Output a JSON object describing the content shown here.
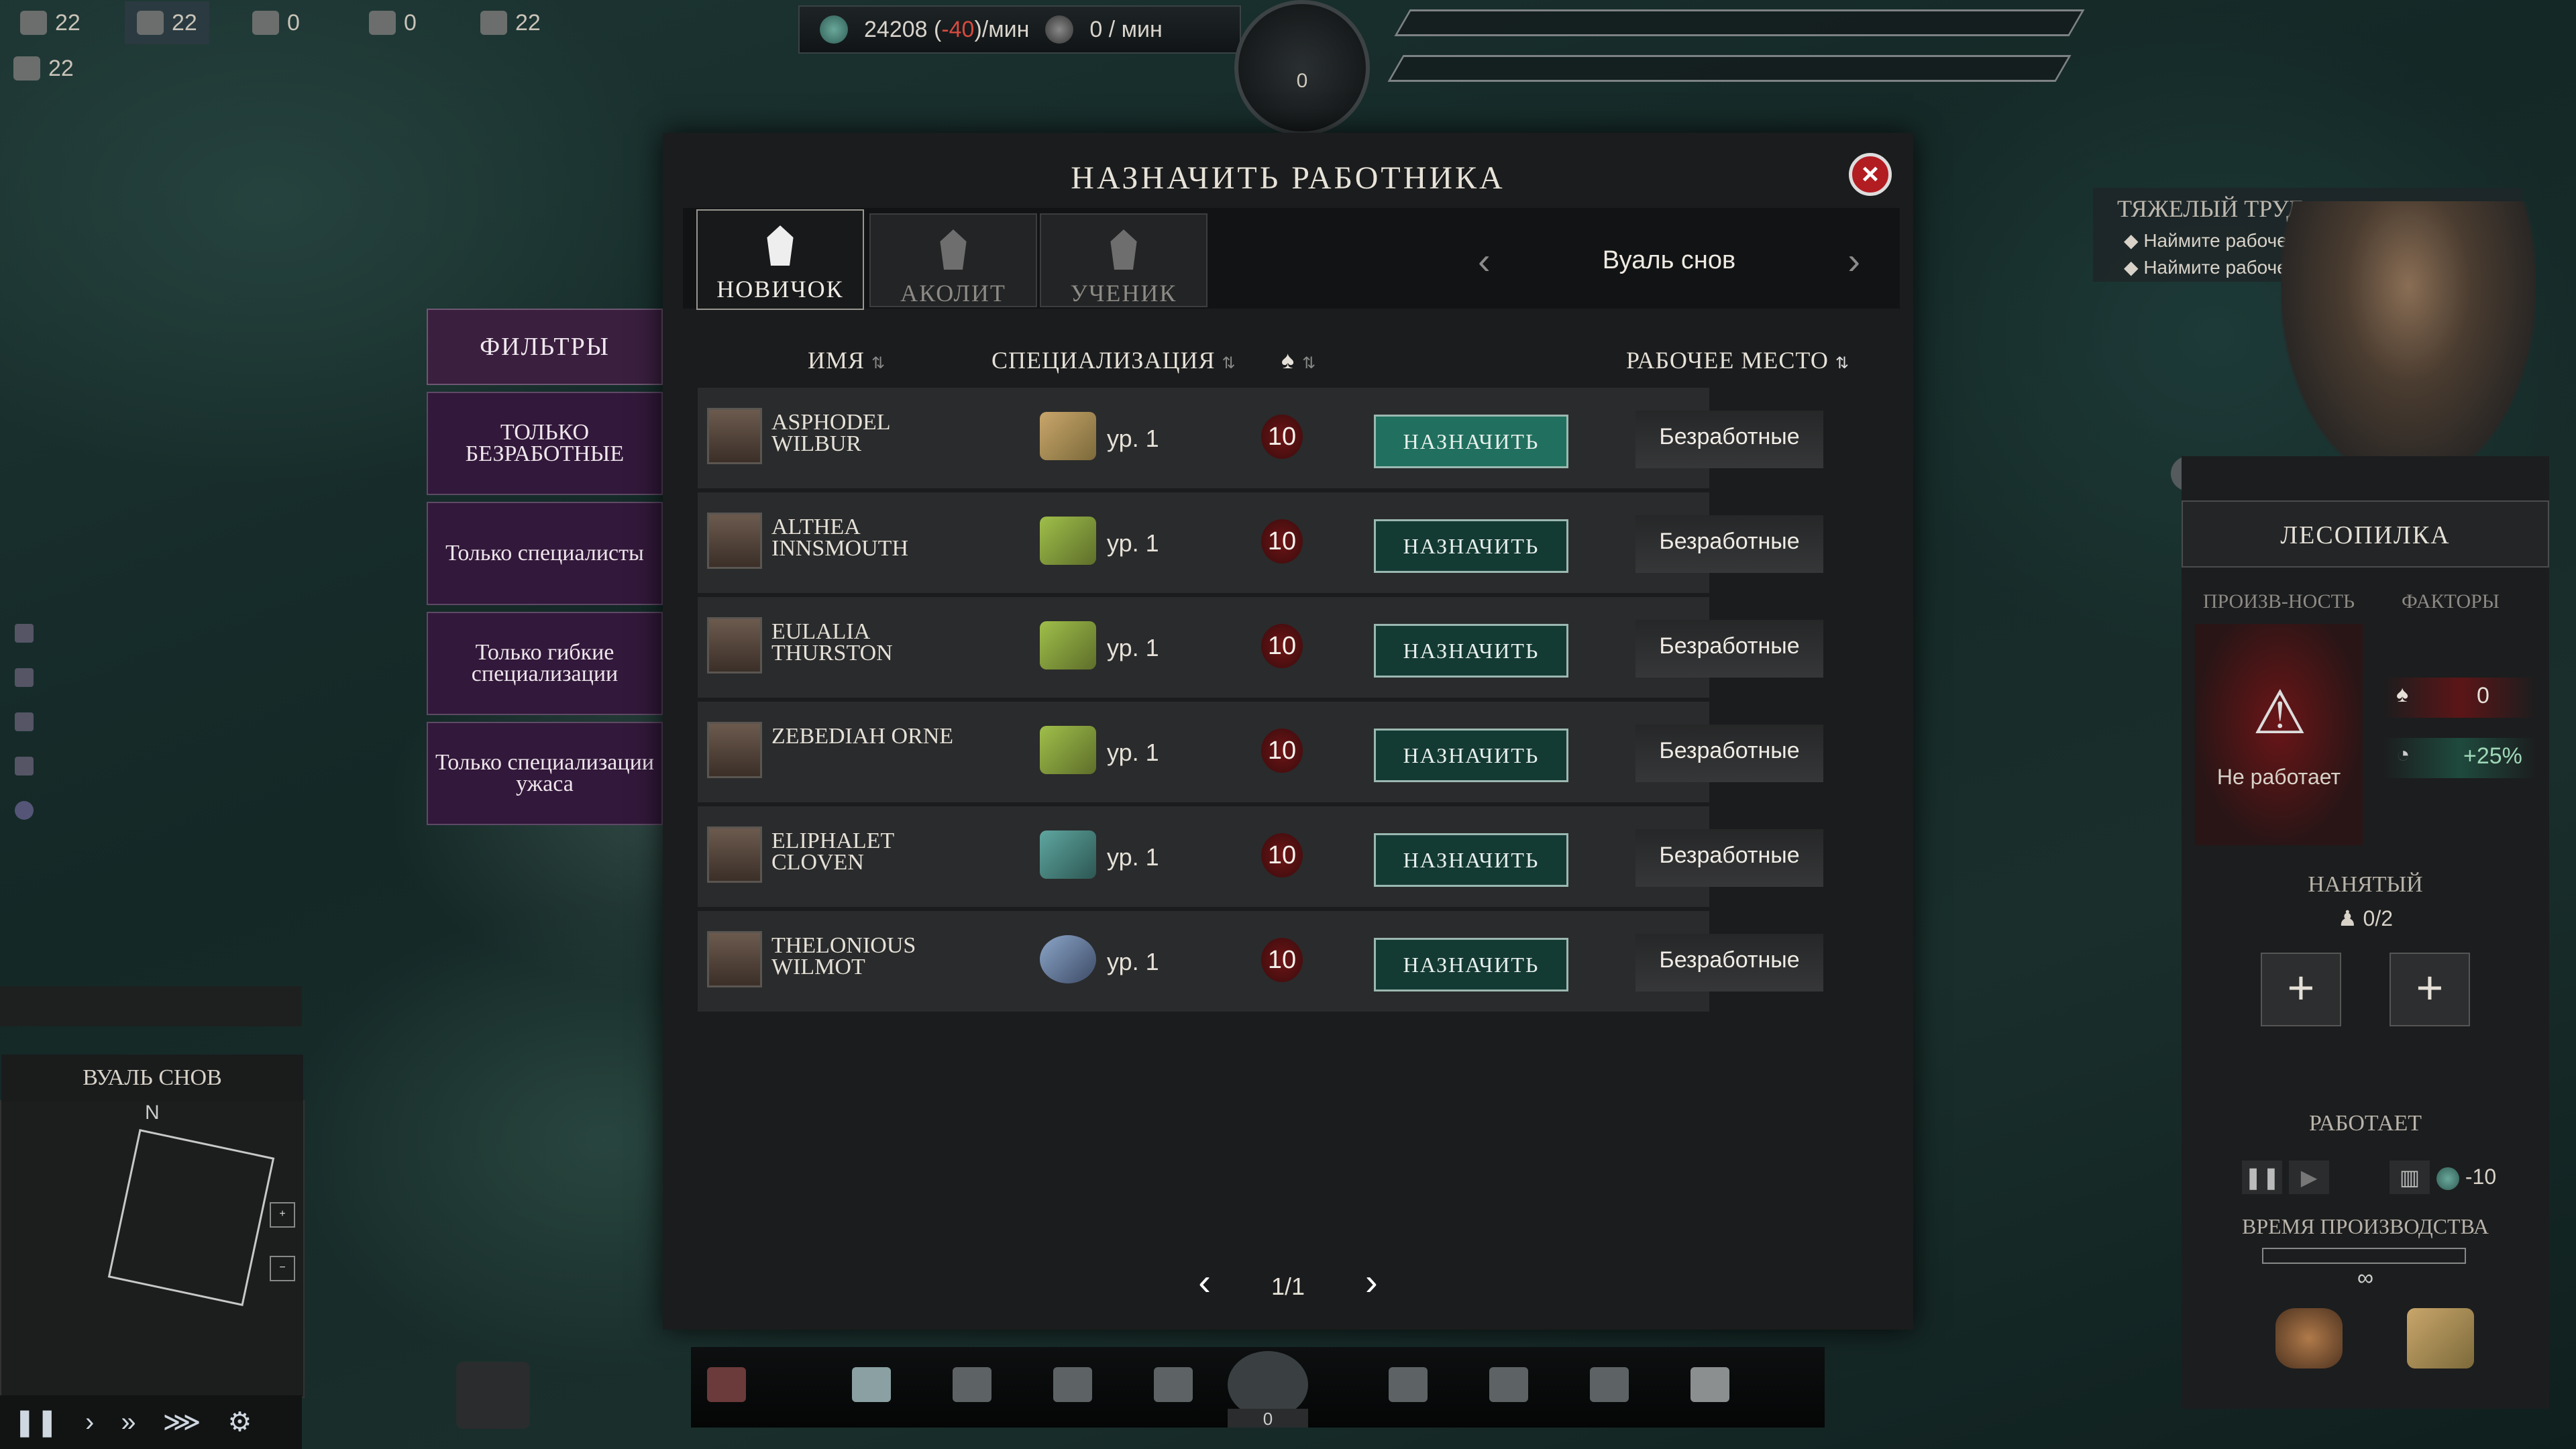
{
  "hud": {
    "resources_row1": [
      "22",
      "22",
      "0",
      "0",
      "22"
    ],
    "resources_row2": "22",
    "currency_amount": "24208",
    "currency_delta": "-40",
    "currency_unit": "/мин",
    "secondary_rate": "0 / мин",
    "emblem_value": "0"
  },
  "modal": {
    "title": "НАЗНАЧИТЬ РАБОТНИКА",
    "tabs": [
      {
        "label": "НОВИЧОК",
        "active": true
      },
      {
        "label": "АКОЛИТ",
        "active": false
      },
      {
        "label": "УЧЕНИК",
        "active": false
      }
    ],
    "region": "Вуаль снов",
    "columns": {
      "name": "ИМЯ",
      "spec": "СПЕЦИАЛИЗАЦИЯ",
      "workplace": "РАБОЧЕЕ МЕСТО"
    },
    "workers": [
      {
        "name": "ASPHODEL WILBUR",
        "level": "ур. 1",
        "fear": "10",
        "action": "НАЗНАЧИТЬ",
        "workplace": "Безработные"
      },
      {
        "name": "ALTHEA INNSMOUTH",
        "level": "ур. 1",
        "fear": "10",
        "action": "НАЗНАЧИТЬ",
        "workplace": "Безработные"
      },
      {
        "name": "EULALIA THURSTON",
        "level": "ур. 1",
        "fear": "10",
        "action": "НАЗНАЧИТЬ",
        "workplace": "Безработные"
      },
      {
        "name": "ZEBEDIAH ORNE",
        "level": "ур. 1",
        "fear": "10",
        "action": "НАЗНАЧИТЬ",
        "workplace": "Безработные"
      },
      {
        "name": "ELIPHALET CLOVEN",
        "level": "ур. 1",
        "fear": "10",
        "action": "НАЗНАЧИТЬ",
        "workplace": "Безработные"
      },
      {
        "name": "THELONIOUS WILMOT",
        "level": "ур. 1",
        "fear": "10",
        "action": "НАЗНАЧИТЬ",
        "workplace": "Безработные"
      }
    ],
    "page": "1/1"
  },
  "filters": {
    "title": "ФИЛЬТРЫ",
    "items": [
      "Только безработные",
      "Только специалисты",
      "Только гибкие специализации",
      "Только специализации ужаса"
    ]
  },
  "tooltip": {
    "title": "ТЯЖЕЛЫЙ ТРУД",
    "lines": [
      "Наймите рабочего",
      "Наймите рабочего"
    ]
  },
  "building": {
    "name": "ЛЕСОПИЛКА",
    "production_label": "ПРОИЗВ-НОСТЬ",
    "factors_label": "ФАКТОРЫ",
    "status": "Не работает",
    "factor_fear": "0",
    "factor_bonus": "+25%",
    "hired_label": "НАНЯТЫЙ",
    "hired_count": "0/2",
    "working_label": "РАБОТАЕТ",
    "cost": "-10",
    "time_label": "ВРЕМЯ ПРОИЗВОДСТВА",
    "time_value": "∞"
  },
  "minimap": {
    "title": "ВУАЛЬ СНОВ",
    "north": "N"
  },
  "bottom": {
    "counter": "0"
  },
  "colors": {
    "accent": "#21705f",
    "fear": "#6e1516",
    "filter": "#32183a",
    "close": "#b21d22"
  }
}
